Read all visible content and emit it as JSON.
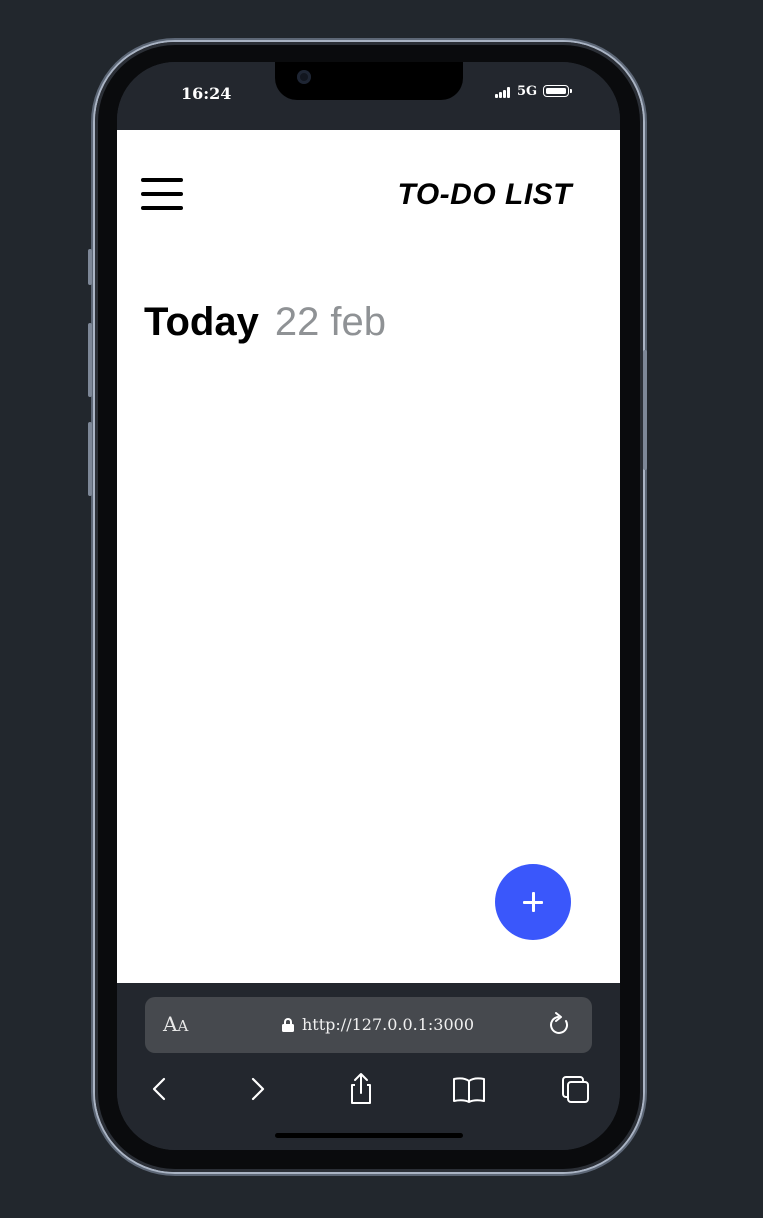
{
  "status": {
    "time": "16:24",
    "network": "5G"
  },
  "app": {
    "title": "TO-DO LIST",
    "day_label": "Today",
    "date_label": "22 feb",
    "accent_color": "#3a57fb"
  },
  "browser": {
    "text_size_label": "A",
    "text_size_label_small": "A",
    "url": "http://127.0.0.1:3000"
  },
  "icons": {
    "menu": "hamburger-menu-icon",
    "add": "plus-icon",
    "lock": "lock-icon",
    "reload": "reload-icon",
    "back": "chevron-left-icon",
    "forward": "chevron-right-icon",
    "share": "share-icon",
    "bookmarks": "book-icon",
    "tabs": "tabs-icon"
  }
}
